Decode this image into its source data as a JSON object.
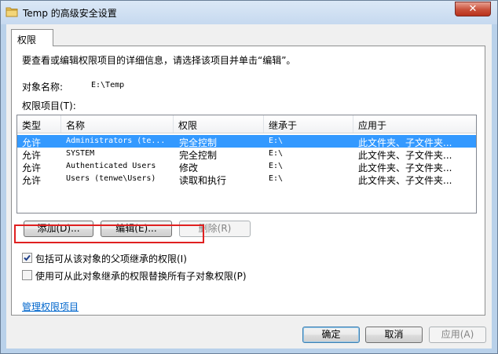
{
  "window": {
    "title": "Temp 的高级安全设置",
    "close_label": "✕"
  },
  "tab": {
    "label": "权限"
  },
  "panel": {
    "intro": "要查看或编辑权限项目的详细信息，请选择该项目并单击“编辑”。",
    "object_name_label": "对象名称:",
    "object_name_value": "E:\\Temp",
    "entries_label": "权限项目(T):"
  },
  "table": {
    "headers": [
      "类型",
      "名称",
      "权限",
      "继承于",
      "应用于"
    ],
    "rows": [
      {
        "type": "允许",
        "name": "Administrators (te...",
        "permission": "完全控制",
        "inherited": "E:\\",
        "applies": "此文件夹、子文件夹...",
        "selected": true
      },
      {
        "type": "允许",
        "name": "SYSTEM",
        "permission": "完全控制",
        "inherited": "E:\\",
        "applies": "此文件夹、子文件夹...",
        "selected": false
      },
      {
        "type": "允许",
        "name": "Authenticated Users",
        "permission": "修改",
        "inherited": "E:\\",
        "applies": "此文件夹、子文件夹...",
        "selected": false
      },
      {
        "type": "允许",
        "name": "Users (tenwe\\Users)",
        "permission": "读取和执行",
        "inherited": "E:\\",
        "applies": "此文件夹、子文件夹...",
        "selected": false
      }
    ]
  },
  "buttons": {
    "add": "添加(D)...",
    "edit": "编辑(E)...",
    "remove": "删除(R)"
  },
  "checkboxes": {
    "inherit": {
      "label": "包括可从该对象的父项继承的权限(I)",
      "checked": true
    },
    "replace": {
      "label": "使用可从此对象继承的权限替换所有子对象权限(P)",
      "checked": false
    }
  },
  "link": {
    "label": "管理权限项目"
  },
  "footer": {
    "ok": "确定",
    "cancel": "取消",
    "apply": "应用(A)"
  },
  "colors": {
    "selection": "#3399ff",
    "highlight_box": "#e02020",
    "link": "#0066cc"
  }
}
